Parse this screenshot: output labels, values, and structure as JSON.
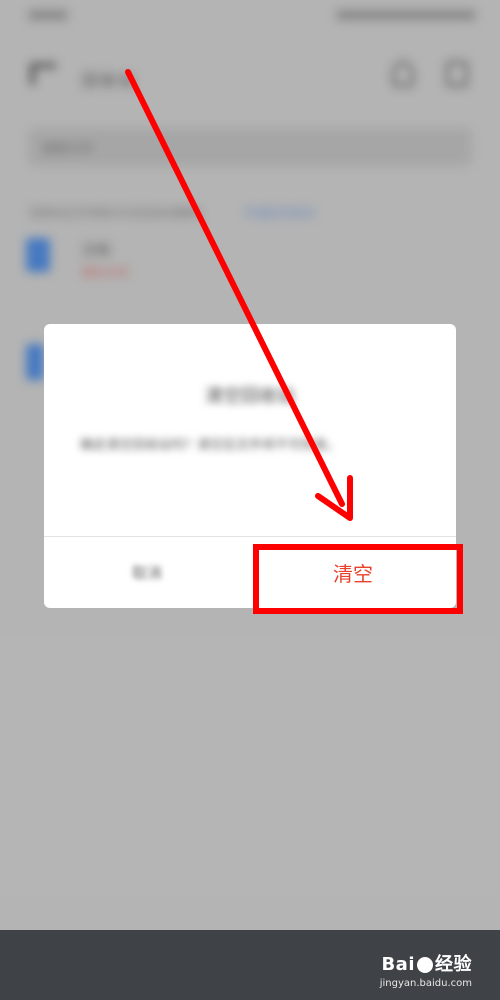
{
  "app": {
    "title": "回收站",
    "search_placeholder": "搜索文件",
    "notice": "回收站文件保存30天后自动删除",
    "notice_link": "开通会员延长",
    "files": [
      {
        "name": "文档",
        "meta": "剩余30天"
      }
    ]
  },
  "dialog": {
    "title": "清空回收站",
    "message": "确定清空回收站吗？清空后文件将不可恢复。",
    "cancel_label": "取消",
    "confirm_label": "清空"
  },
  "watermark": {
    "brand_left": "Bai",
    "brand_right": "经验",
    "url": "jingyan.baidu.com"
  },
  "colors": {
    "confirm": "#e8402a",
    "annotation": "#ff0000",
    "bottom_bar": "#3f4347"
  }
}
